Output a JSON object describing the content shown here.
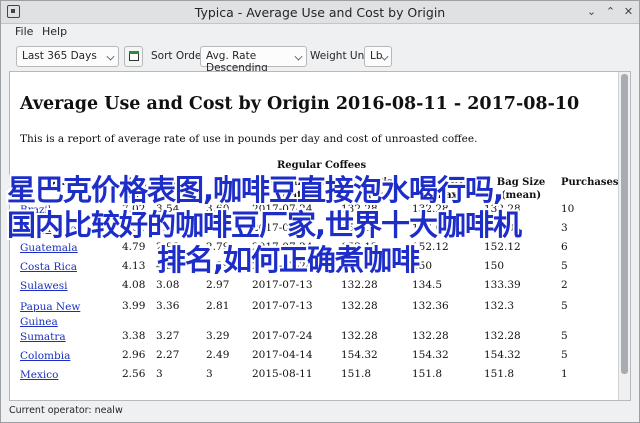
{
  "window": {
    "title": "Typica - Average Use and Cost by Origin"
  },
  "menu": {
    "file": "File",
    "help": "Help"
  },
  "toolbar": {
    "date_range": "Last 365 Days",
    "sort_label": "Sort Order:",
    "sort_value": "Avg. Rate Descending",
    "weight_label": "Weight Unit:",
    "weight_value": "Lb"
  },
  "report": {
    "title": "Average Use and Cost by Origin 2016-08-11 - 2017-08-10",
    "intro": "This is a report of average rate of use in pounds per day and cost of unroasted coffee.",
    "group_header": "Regular Coffees",
    "columns": [
      "Origin",
      "Avg Rate",
      "Avg Cost",
      "Avg Cost",
      "Last Purchase Date",
      "Bag Size (min)",
      "Bag Size (max)",
      "Bag Size (mean)",
      "Purchases"
    ],
    "rows": [
      [
        "Brazil",
        "7.02",
        "3.54",
        "3.60",
        "2017-07-24",
        "132.28",
        "132.28",
        "132.28",
        "10"
      ],
      [
        "El Salvador",
        "6.51",
        "3.58",
        "3.54",
        "2017-07-13",
        "152.08",
        "152.08",
        "152.08",
        "3"
      ],
      [
        "Guatemala",
        "4.79",
        "2.98",
        "2.79",
        "2017-07-24",
        "152.12",
        "152.12",
        "152.12",
        "6"
      ],
      [
        "Costa Rica",
        "4.13",
        "4.99",
        "4.99",
        "2017-07-24",
        "150",
        "150",
        "150",
        "5"
      ],
      [
        "Sulawesi",
        "4.08",
        "3.08",
        "2.97",
        "2017-07-13",
        "132.28",
        "134.5",
        "133.39",
        "2"
      ],
      [
        "Papua New Guinea",
        "3.99",
        "3.36",
        "2.81",
        "2017-07-13",
        "132.28",
        "132.36",
        "132.3",
        "5"
      ],
      [
        "Sumatra",
        "3.38",
        "3.27",
        "3.29",
        "2017-07-24",
        "132.28",
        "132.28",
        "132.28",
        "5"
      ],
      [
        "Colombia",
        "2.96",
        "2.27",
        "2.49",
        "2017-04-14",
        "154.32",
        "154.32",
        "154.32",
        "5"
      ],
      [
        "Mexico",
        "2.56",
        "3",
        "3",
        "2015-08-11",
        "151.8",
        "151.8",
        "151.8",
        "1"
      ]
    ]
  },
  "status": {
    "text": "Current operator: nealw"
  },
  "overlay": {
    "line1": "星巴克价格表图,咖啡豆直接泡水喝行吗,",
    "line2": "国内比较好的咖啡豆厂家,世界十大咖啡机",
    "line3": "排名,如何正确煮咖啡"
  }
}
